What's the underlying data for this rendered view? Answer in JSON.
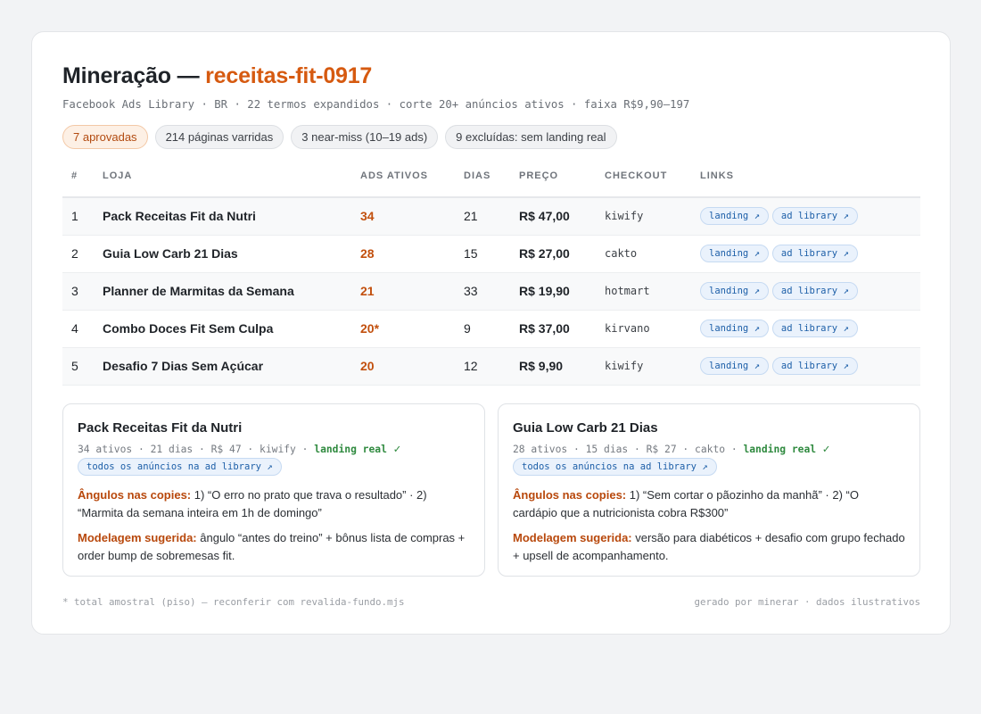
{
  "header": {
    "title_prefix": "Mineração — ",
    "title_accent": "receitas-fit-0917",
    "subtitle": "Facebook Ads Library · BR · 22 termos expandidos · corte 20+ anúncios ativos · faixa R$9,90–197"
  },
  "chips": {
    "approved": "7 aprovadas",
    "pages": "214 páginas varridas",
    "near_miss": "3 near-miss (10–19 ads)",
    "excluded": "9 excluídas: sem landing real"
  },
  "table": {
    "headers": {
      "num": "#",
      "loja": "LOJA",
      "ads": "ADS ATIVOS",
      "dias": "DIAS",
      "preco": "PREÇO",
      "checkout": "CHECKOUT",
      "links": "LINKS"
    },
    "link_labels": {
      "landing": "landing ↗",
      "ad_library": "ad library ↗"
    },
    "rows": [
      {
        "num": "1",
        "loja": "Pack Receitas Fit da Nutri",
        "ads": "34",
        "dias": "21",
        "preco": "R$ 47,00",
        "checkout": "kiwify"
      },
      {
        "num": "2",
        "loja": "Guia Low Carb 21 Dias",
        "ads": "28",
        "dias": "15",
        "preco": "R$ 27,00",
        "checkout": "cakto"
      },
      {
        "num": "3",
        "loja": "Planner de Marmitas da Semana",
        "ads": "21",
        "dias": "33",
        "preco": "R$ 19,90",
        "checkout": "hotmart"
      },
      {
        "num": "4",
        "loja": "Combo Doces Fit Sem Culpa",
        "ads": "20*",
        "dias": "9",
        "preco": "R$ 37,00",
        "checkout": "kirvano"
      },
      {
        "num": "5",
        "loja": "Desafio 7 Dias Sem Açúcar",
        "ads": "20",
        "dias": "12",
        "preco": "R$ 9,90",
        "checkout": "kiwify"
      }
    ]
  },
  "details": [
    {
      "title": "Pack Receitas Fit da Nutri",
      "meta": "34 ativos · 21 dias · R$ 47 · kiwify · ",
      "landing_ok": "landing real",
      "check": "✓",
      "all_ads": "todos os anúncios na ad library ↗",
      "angles_label": "Ângulos nas copies:",
      "angles_text": " 1) “O erro no prato que trava o resultado” · 2) “Marmita da semana inteira em 1h de domingo”",
      "model_label": "Modelagem sugerida:",
      "model_text": " ângulo “antes do treino” + bônus lista de compras + order bump de sobremesas fit."
    },
    {
      "title": "Guia Low Carb 21 Dias",
      "meta": "28 ativos · 15 dias · R$ 27 · cakto · ",
      "landing_ok": "landing real",
      "check": "✓",
      "all_ads": "todos os anúncios na ad library ↗",
      "angles_label": "Ângulos nas copies:",
      "angles_text": " 1) “Sem cortar o pãozinho da manhã” · 2) “O cardápio que a nutricionista cobra R$300”",
      "model_label": "Modelagem sugerida:",
      "model_text": " versão para diabéticos + desafio com grupo fechado + upsell de acompanhamento."
    }
  ],
  "footer": {
    "left": "* total amostral (piso) — reconferir com revalida-fundo.mjs",
    "right": "gerado por minerar · dados ilustrativos"
  }
}
